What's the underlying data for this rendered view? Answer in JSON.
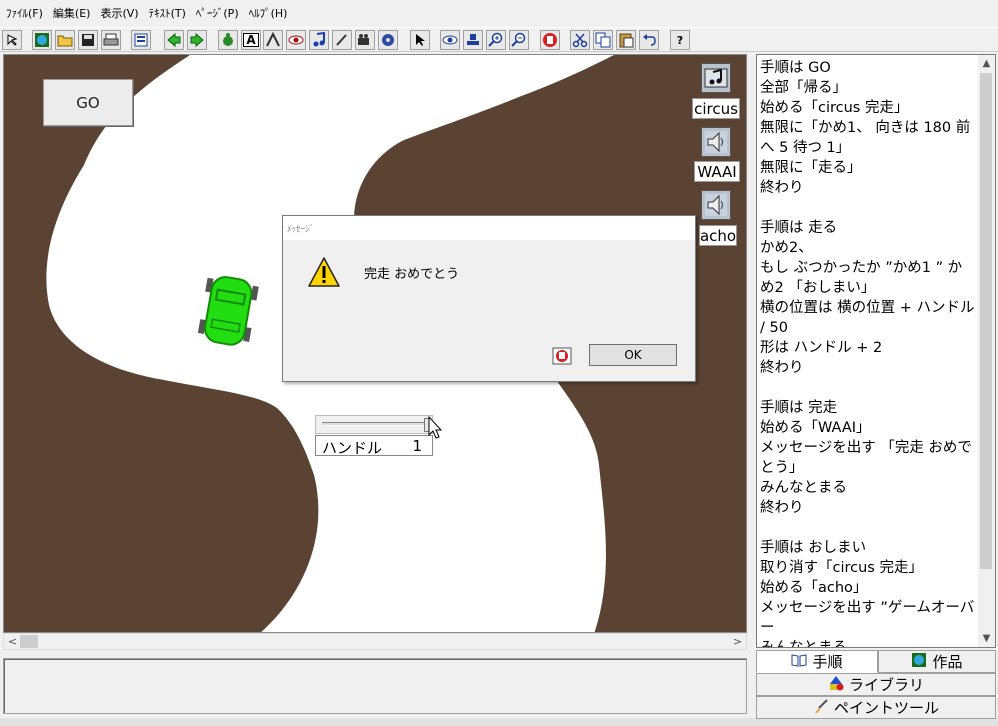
{
  "menubar": {
    "items": [
      "ﾌｧｲﾙ(F)",
      "編集(E)",
      "表示(V)",
      "ﾃｷｽﾄ(T)",
      "ﾍﾟｰｼﾞ(P)",
      "ﾍﾙﾌﾟ(H)"
    ]
  },
  "toolbar": {
    "help_label": "?",
    "text_tool_label": "A"
  },
  "stage": {
    "go_button_label": "GO",
    "sounds": [
      {
        "label": "circus",
        "icon": "music-note-icon"
      },
      {
        "label": "WAAI",
        "icon": "speaker-icon"
      },
      {
        "label": "acho",
        "icon": "speaker-icon"
      }
    ],
    "slider": {
      "label": "ハンドル",
      "value": "1"
    },
    "colors": {
      "track_edge": "#5a4333",
      "road": "#ffffff",
      "car": "#22dd11"
    }
  },
  "dialog": {
    "title": "ﾒｯｾｰｼﾞ",
    "message": "完走 おめでとう",
    "ok_label": "OK"
  },
  "script": {
    "text": "手順は GO\n全部「帰る」\n始める「circus 完走」\n無限に「かめ1、 向きは 180 前へ 5 待つ 1」\n無限に「走る」\n終わり\n\n手順は 走る\nかめ2、\nもし ぶつかったか ”かめ1 ” かめ2 「おしまい」\n横の位置は 横の位置 + ハンドル / 50\n形は ハンドル + 2\n終わり\n\n手順は 完走\n始める「WAAI」\nメッセージを出す 「完走 おめでとう」\nみんなとまる\n終わり\n\n手順は おしまい\n取り消す「circus 完走」\n始める「acho」\nメッセージを出す ”ゲームオーバー\nみんなとまる"
  },
  "tabs": {
    "procedures": "手順",
    "works": "作品",
    "library": "ライブラリ",
    "paint_tool": "ペイントツール"
  }
}
